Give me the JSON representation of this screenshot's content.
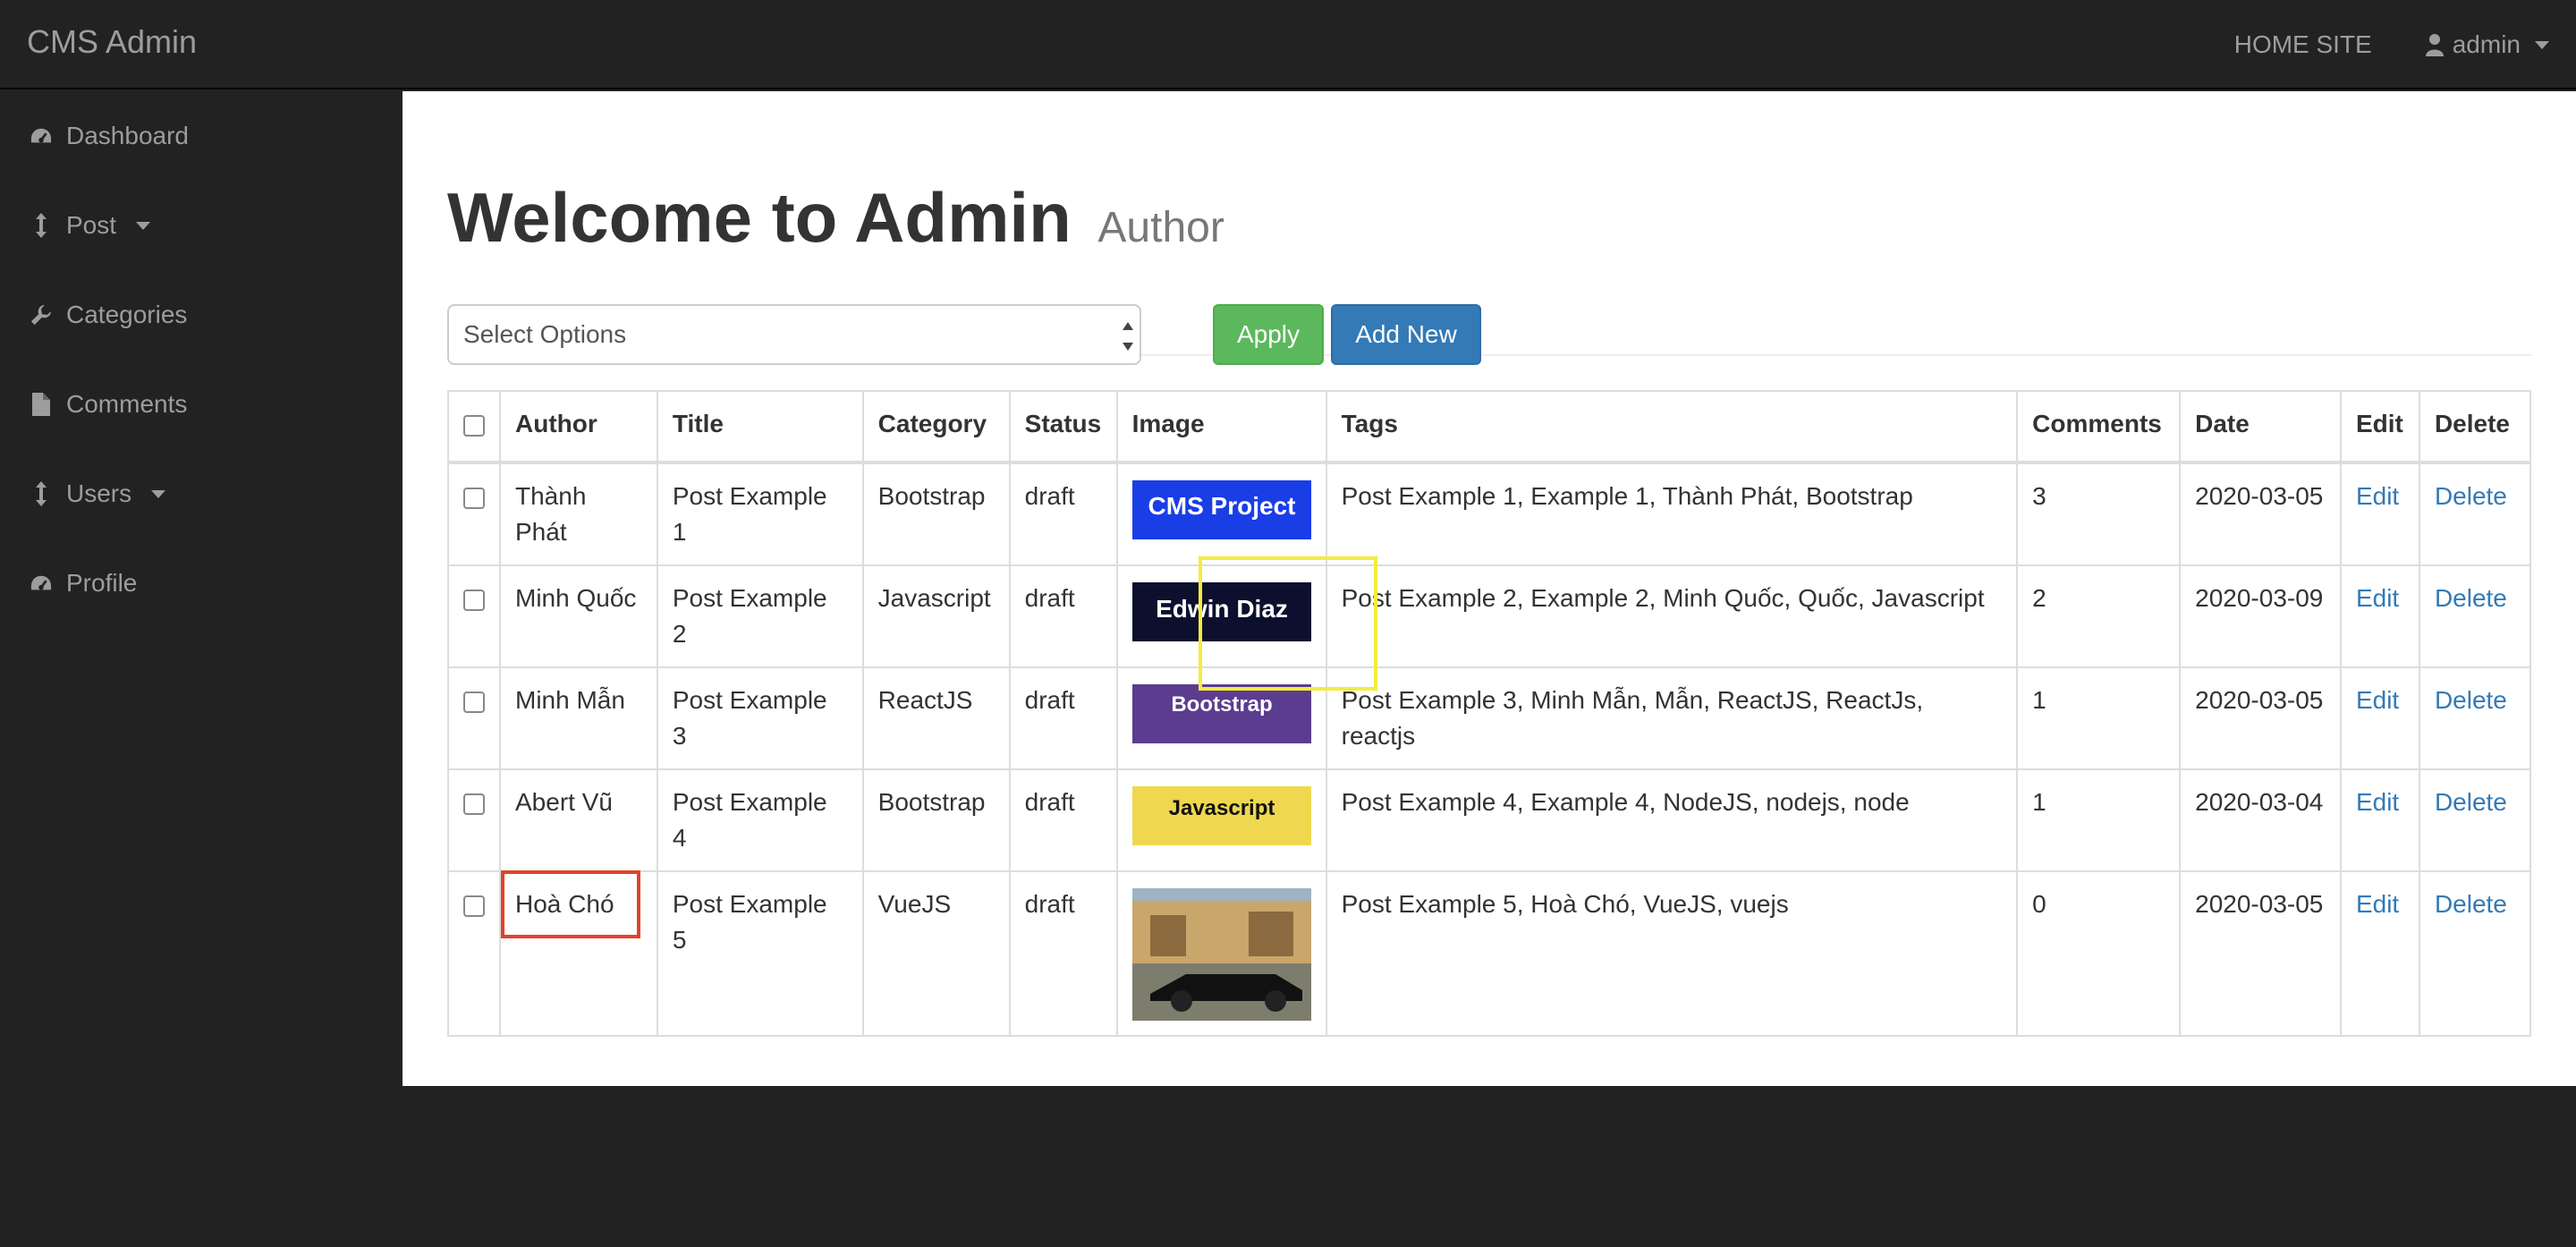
{
  "navbar": {
    "brand": "CMS Admin",
    "home_site": "HOME SITE",
    "user": "admin"
  },
  "sidebar": {
    "items": [
      {
        "label": "Dashboard",
        "icon": "dashboard-icon"
      },
      {
        "label": "Post",
        "icon": "arrows-v-icon",
        "dropdown": true
      },
      {
        "label": "Categories",
        "icon": "wrench-icon"
      },
      {
        "label": "Comments",
        "icon": "file-icon"
      },
      {
        "label": "Users",
        "icon": "arrows-v-icon",
        "dropdown": true
      },
      {
        "label": "Profile",
        "icon": "dashboard-icon"
      }
    ]
  },
  "header": {
    "title": "Welcome to Admin",
    "subtitle": "Author"
  },
  "controls": {
    "select_value": "Select Options",
    "apply": "Apply",
    "add_new": "Add New"
  },
  "table": {
    "columns": [
      "Author",
      "Title",
      "Category",
      "Status",
      "Image",
      "Tags",
      "Comments",
      "Date",
      "Edit",
      "Delete"
    ],
    "rows": [
      {
        "author": "Thành Phát",
        "title": "Post Example 1",
        "category": "Bootstrap",
        "status": "draft",
        "image_text": "CMS Project",
        "tags": "Post Example 1, Example 1, Thành Phát, Bootstrap",
        "comments": "3",
        "date": "2020-03-05",
        "edit": "Edit",
        "delete": "Delete"
      },
      {
        "author": "Minh Quốc",
        "title": "Post Example 2",
        "category": "Javascript",
        "status": "draft",
        "image_text": "Edwin Diaz",
        "tags": "Post Example 2, Example 2, Minh Quốc, Quốc, Javascript",
        "comments": "2",
        "date": "2020-03-09",
        "edit": "Edit",
        "delete": "Delete"
      },
      {
        "author": "Minh Mẫn",
        "title": "Post Example 3",
        "category": "ReactJS",
        "status": "draft",
        "image_text": "Bootstrap",
        "tags": "Post Example 3, Minh Mẫn, Mẫn, ReactJS, ReactJs, reactjs",
        "comments": "1",
        "date": "2020-03-05",
        "edit": "Edit",
        "delete": "Delete"
      },
      {
        "author": "Abert Vũ",
        "title": "Post Example 4",
        "category": "Bootstrap",
        "status": "draft",
        "image_text": "Javascript",
        "tags": "Post Example 4, Example 4, NodeJS, nodejs, node",
        "comments": "1",
        "date": "2020-03-04",
        "edit": "Edit",
        "delete": "Delete"
      },
      {
        "author": "Hoà Chó",
        "title": "Post Example 5",
        "category": "VueJS",
        "status": "draft",
        "image_text": "",
        "tags": "Post Example 5, Hoà Chó, VueJS, vuejs",
        "comments": "0",
        "date": "2020-03-05",
        "edit": "Edit",
        "delete": "Delete"
      }
    ]
  },
  "colors": {
    "navbar": "#222222",
    "apply": "#5cb85c",
    "add_new": "#337ab7",
    "link": "#337ab7",
    "highlight_red": "#e0442b",
    "highlight_yellow": "#f4ec3c"
  }
}
